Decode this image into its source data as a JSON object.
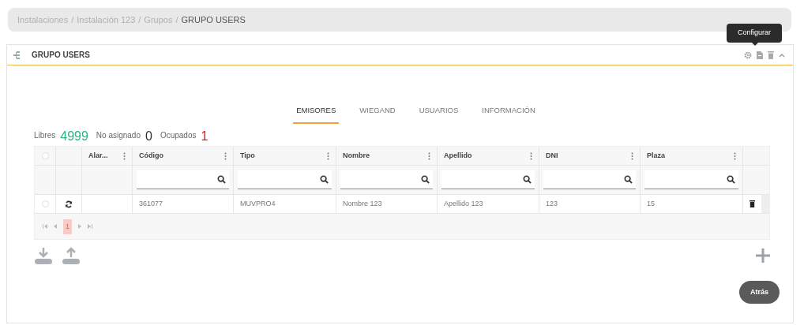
{
  "breadcrumb_separator": "/",
  "breadcrumb": [
    {
      "label": "Instalaciones",
      "current": false
    },
    {
      "label": "Instalación 123",
      "current": false
    },
    {
      "label": "Grupos",
      "current": false
    },
    {
      "label": "GRUPO USERS",
      "current": true
    }
  ],
  "panel": {
    "title": "GRUPO USERS",
    "tooltip": "Configurar"
  },
  "tabs": [
    {
      "label": "EMISORES",
      "selected": true
    },
    {
      "label": "WIEGAND",
      "selected": false
    },
    {
      "label": "USUARIOS",
      "selected": false
    },
    {
      "label": "INFORMACIÓN",
      "selected": false
    }
  ],
  "counters": [
    {
      "label": "Libres",
      "value": "4999",
      "color": "#2bb38a"
    },
    {
      "label": "No asignado",
      "value": "0",
      "color": "#333333"
    },
    {
      "label": "Ocupados",
      "value": "1",
      "color": "#e01b1b"
    }
  ],
  "table": {
    "columns": [
      {
        "label": "Alar...",
        "filter": false
      },
      {
        "label": "Código",
        "filter": true
      },
      {
        "label": "Tipo",
        "filter": true
      },
      {
        "label": "Nombre",
        "filter": true
      },
      {
        "label": "Apellido",
        "filter": true
      },
      {
        "label": "DNI",
        "filter": true
      },
      {
        "label": "Plaza",
        "filter": true
      }
    ],
    "select_all_checked": false,
    "rows": [
      {
        "checked": false,
        "cells": [
          "",
          "361077",
          "MUVPRO4",
          "Nombre 123",
          "Apellido 123",
          "123",
          "15"
        ]
      }
    ],
    "pages": [
      {
        "label": "1",
        "selected": true
      }
    ]
  },
  "buttons": {
    "back": "Atrás"
  }
}
